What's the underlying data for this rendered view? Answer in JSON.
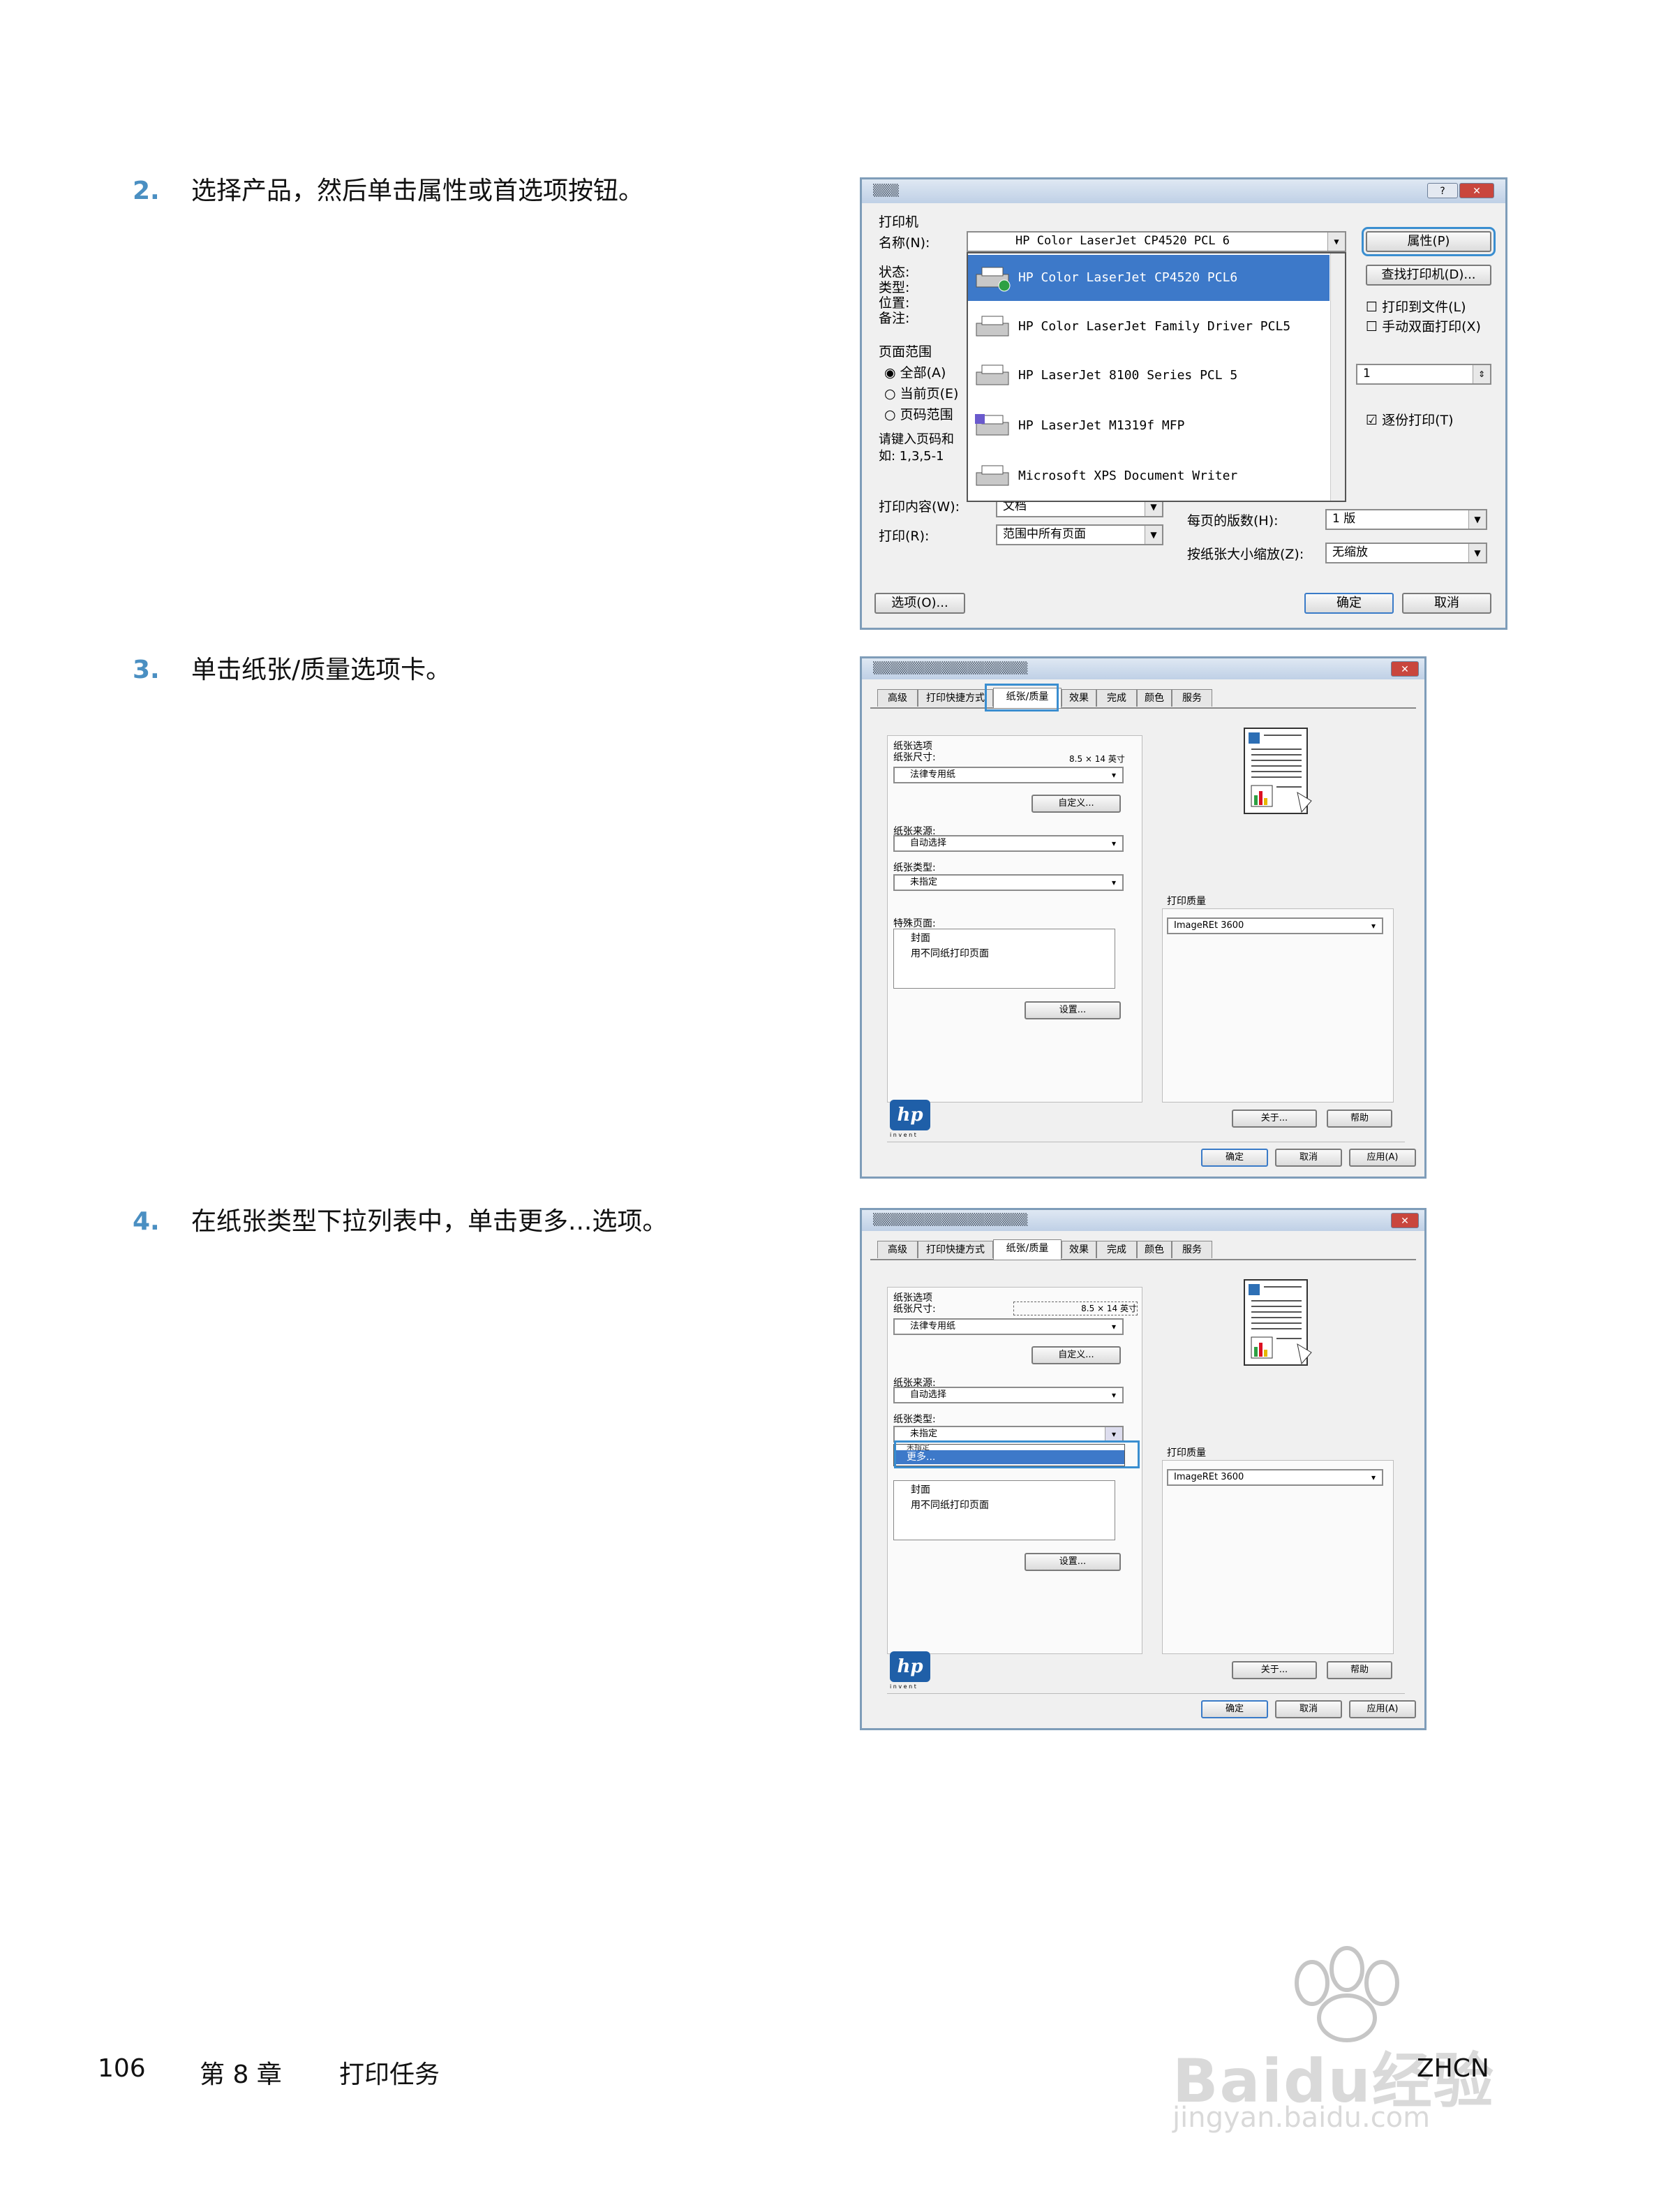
{
  "steps": [
    {
      "num": "2.",
      "text": "选择产品，然后单击属性或首选项按钮。"
    },
    {
      "num": "3.",
      "text": "单击纸张/质量选项卡。"
    },
    {
      "num": "4.",
      "text": "在纸张类型下拉列表中，单击更多...选项。"
    }
  ],
  "shot1": {
    "title_btns": [
      "?",
      "✕"
    ],
    "printer_group": "打印机",
    "name_label": "名称(N):",
    "name_value": "HP Color LaserJet CP4520 PCL 6",
    "status_labels": [
      "状态:",
      "类型:",
      "位置:",
      "备注:"
    ],
    "properties_button": "属性(P)",
    "find_printer_button": "查找打印机(D)...",
    "print_to_file": "打印到文件(L)",
    "manual_duplex": "手动双面打印(X)",
    "page_range": "页面范围",
    "range_all": "全部(A)",
    "range_current": "当前页(E)",
    "range_pages": "页码范围",
    "page_hint_1": "请键入页码和",
    "page_hint_2": "如: 1,3,5-1",
    "copies_value": "1",
    "collate": "逐份打印(T)",
    "print_what_label": "打印内容(W):",
    "print_what_value": "文档",
    "print_label": "打印(R):",
    "print_value": "范围中所有页面",
    "pages_per_sheet_label": "每页的版数(H):",
    "pages_per_sheet_value": "1 版",
    "scale_label": "按纸张大小缩放(Z):",
    "scale_value": "无缩放",
    "options_button": "选项(O)...",
    "ok_button": "确定",
    "cancel_button": "取消",
    "printers": [
      "HP Color LaserJet CP4520 PCL6",
      "HP Color LaserJet Family Driver PCL5",
      "HP LaserJet 8100 Series PCL 5",
      "HP LaserJet M1319f MFP",
      "Microsoft XPS Document Writer"
    ]
  },
  "shot2": {
    "tabs": [
      "高级",
      "打印快捷方式",
      "纸张/质量",
      "效果",
      "完成",
      "颜色",
      "服务"
    ],
    "paper_options": "纸张选项",
    "paper_size_label": "纸张尺寸:",
    "paper_size_value": "8.5 × 14 英寸",
    "paper_size_select": "法律专用纸",
    "custom_button": "自定义...",
    "paper_source_label": "纸张来源:",
    "paper_source_value": "自动选择",
    "paper_type_label": "纸张类型:",
    "paper_type_value": "未指定",
    "special_pages_label": "特殊页面:",
    "special_pages_items": [
      "封面",
      "用不同纸打印页面"
    ],
    "settings_button": "设置...",
    "print_quality_label": "打印质量",
    "print_quality_value": "ImageREt 3600",
    "about_button": "关于...",
    "help_button": "帮助",
    "ok_button": "确定",
    "cancel_button": "取消",
    "apply_button": "应用(A)",
    "hp_logo": "hp",
    "hp_tagline": "i n v e n t"
  },
  "shot3": {
    "dropdown_item_hidden": "未指定",
    "dropdown_item_more": "更多..."
  },
  "footer": {
    "page_number": "106",
    "chapter": "第 8 章",
    "chapter_title": "打印任务",
    "locale": "ZHCN"
  },
  "watermark": {
    "text_1": "Baidu经验",
    "text_2": "jingyan.baidu.com"
  },
  "colors": {
    "step_number": "#4a8fc2",
    "highlight": "#3a8ed0",
    "selection": "#3d79c9"
  }
}
